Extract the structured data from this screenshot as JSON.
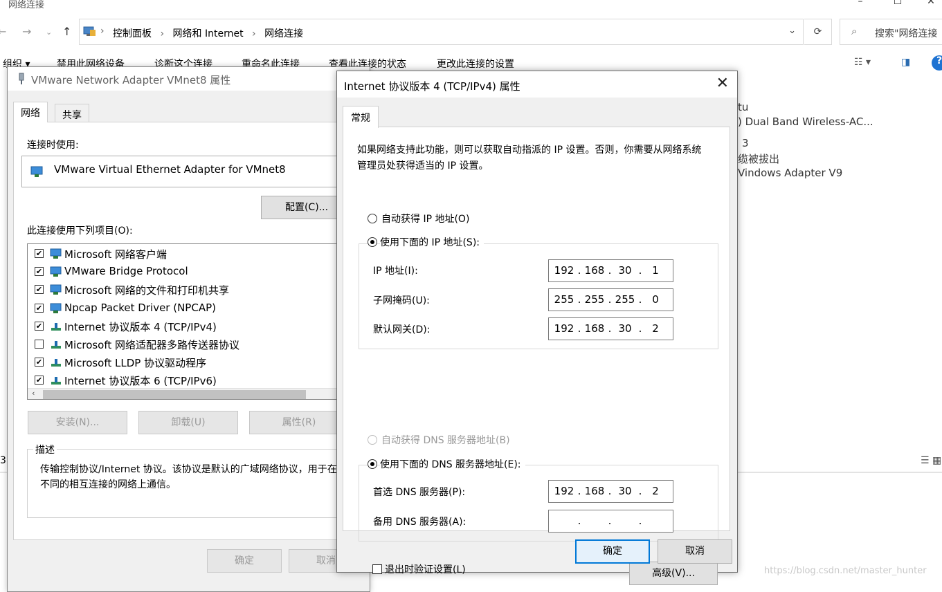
{
  "explorer": {
    "window_title": "网络连接",
    "breadcrumb": [
      "控制面板",
      "网络和 Internet",
      "网络连接"
    ],
    "search_placeholder": "搜索\"网络连接",
    "commands": [
      "组织 ▾",
      "禁用此网络设备",
      "诊断这个连接",
      "重命名此连接",
      "查看此连接的状态",
      "更改此连接的设置"
    ],
    "right_panel_lines": [
      "tu",
      ") Dual Band Wireless-AC...",
      "3",
      "缆被拔出",
      "Vindows Adapter V9"
    ],
    "left_edge_number": "3"
  },
  "adapter_dialog": {
    "title": "VMware Network Adapter VMnet8 属性",
    "tabs": [
      "网络",
      "共享"
    ],
    "connect_using_label": "连接时使用:",
    "adapter_name": "VMware Virtual Ethernet Adapter for VMnet8",
    "configure_button": "配置(C)...",
    "items_label": "此连接使用下列项目(O):",
    "items": [
      {
        "label": "Microsoft 网络客户端",
        "checked": true,
        "icon": "network-client-icon"
      },
      {
        "label": "VMware Bridge Protocol",
        "checked": true,
        "icon": "network-client-icon"
      },
      {
        "label": "Microsoft 网络的文件和打印机共享",
        "checked": true,
        "icon": "network-client-icon"
      },
      {
        "label": "Npcap Packet Driver (NPCAP)",
        "checked": true,
        "icon": "network-client-icon"
      },
      {
        "label": "Internet 协议版本 4 (TCP/IPv4)",
        "checked": true,
        "icon": "protocol-icon"
      },
      {
        "label": "Microsoft 网络适配器多路传送器协议",
        "checked": false,
        "icon": "protocol-icon"
      },
      {
        "label": "Microsoft LLDP 协议驱动程序",
        "checked": true,
        "icon": "protocol-icon"
      },
      {
        "label": "Internet 协议版本 6 (TCP/IPv6)",
        "checked": true,
        "icon": "protocol-icon"
      }
    ],
    "install_button": "安装(N)...",
    "uninstall_button": "卸载(U)",
    "properties_button": "属性(R)",
    "description_legend": "描述",
    "description_text": "传输控制协议/Internet 协议。该协议是默认的广域网络协议，用于在不同的相互连接的网络上通信。",
    "ok_button": "确定",
    "cancel_button": "取消"
  },
  "ipv4_dialog": {
    "title": "Internet 协议版本 4 (TCP/IPv4) 属性",
    "close_glyph": "✕",
    "tab": "常规",
    "intro": "如果网络支持此功能，则可以获取自动指派的 IP 设置。否则，你需要从网络系统管理员处获得适当的 IP 设置。",
    "auto_ip_label": "自动获得 IP 地址(O)",
    "manual_ip_label": "使用下面的 IP 地址(S):",
    "ip_address_label": "IP 地址(I):",
    "ip_address": [
      "192",
      "168",
      "30",
      "1"
    ],
    "subnet_label": "子网掩码(U):",
    "subnet_mask": [
      "255",
      "255",
      "255",
      "0"
    ],
    "gateway_label": "默认网关(D):",
    "gateway": [
      "192",
      "168",
      "30",
      "2"
    ],
    "auto_dns_label": "自动获得 DNS 服务器地址(B)",
    "manual_dns_label": "使用下面的 DNS 服务器地址(E):",
    "preferred_dns_label": "首选 DNS 服务器(P):",
    "preferred_dns": [
      "192",
      "168",
      "30",
      "2"
    ],
    "alternate_dns_label": "备用 DNS 服务器(A):",
    "alternate_dns": [
      "",
      "",
      "",
      ""
    ],
    "validate_label": "退出时验证设置(L)",
    "advanced_button": "高级(V)...",
    "ok_button": "确定",
    "cancel_button": "取消",
    "selection": {
      "ip_mode": "manual",
      "dns_mode": "manual",
      "validate_on_exit": false
    }
  },
  "watermark": "https://blog.csdn.net/master_hunter",
  "colors": {
    "accent": "#0078d7",
    "dialog_bg": "#f0f0f0",
    "border": "#adadad"
  }
}
